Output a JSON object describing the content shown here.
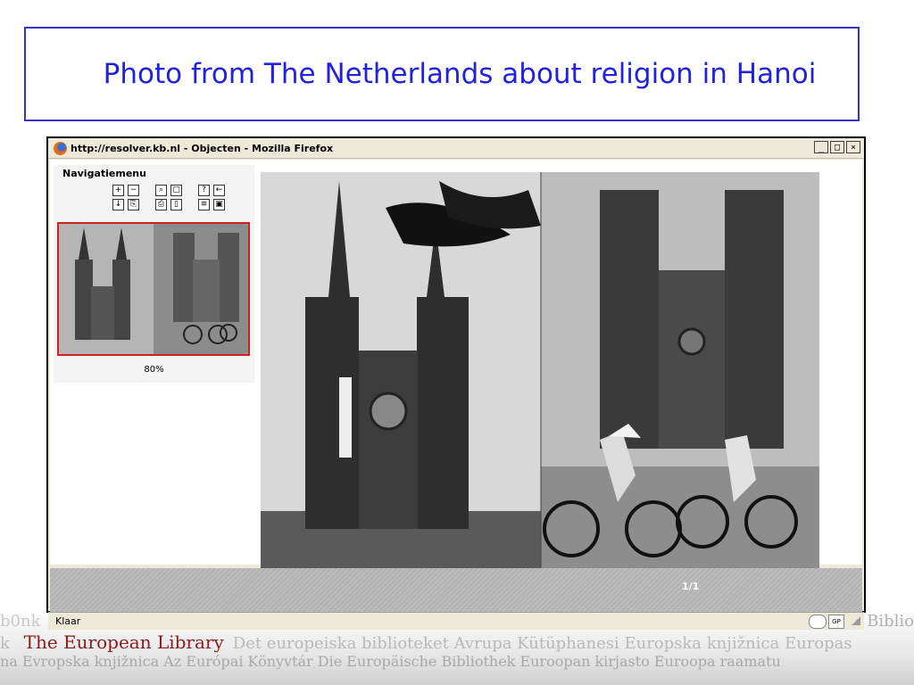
{
  "slide": {
    "title": "Photo from The Netherlands about religion in Hanoi"
  },
  "browser": {
    "title": "http://resolver.kb.nl - Objecten - Mozilla Firefox",
    "buttons": {
      "minimize": "_",
      "maximize": "□",
      "close": "×"
    },
    "status": "Klaar",
    "status_badge": "GP"
  },
  "viewer": {
    "nav_title": "Navigatiemenu",
    "zoom": "80%",
    "pager": "1/1"
  },
  "footer": {
    "logo": "The European Library",
    "line1": "b0nk",
    "line2": "Det europeiska biblioteket  Avrupa Kütüphanesi Europska knjižnica Europas",
    "line3": "na  Evropska knjižnica  Az Európai Könyvtár Die Europäische Bibliothek  Euroopan kirjasto Euroopa raamatu",
    "right": "Biblio"
  },
  "icons": [
    "zoom-in-icon",
    "zoom-out-icon",
    "search-icon",
    "fit-icon",
    "help-icon",
    "back-icon",
    "download-icon",
    "export-icon",
    "print-icon",
    "page-icon",
    "text-icon",
    "thumbnail-icon"
  ]
}
